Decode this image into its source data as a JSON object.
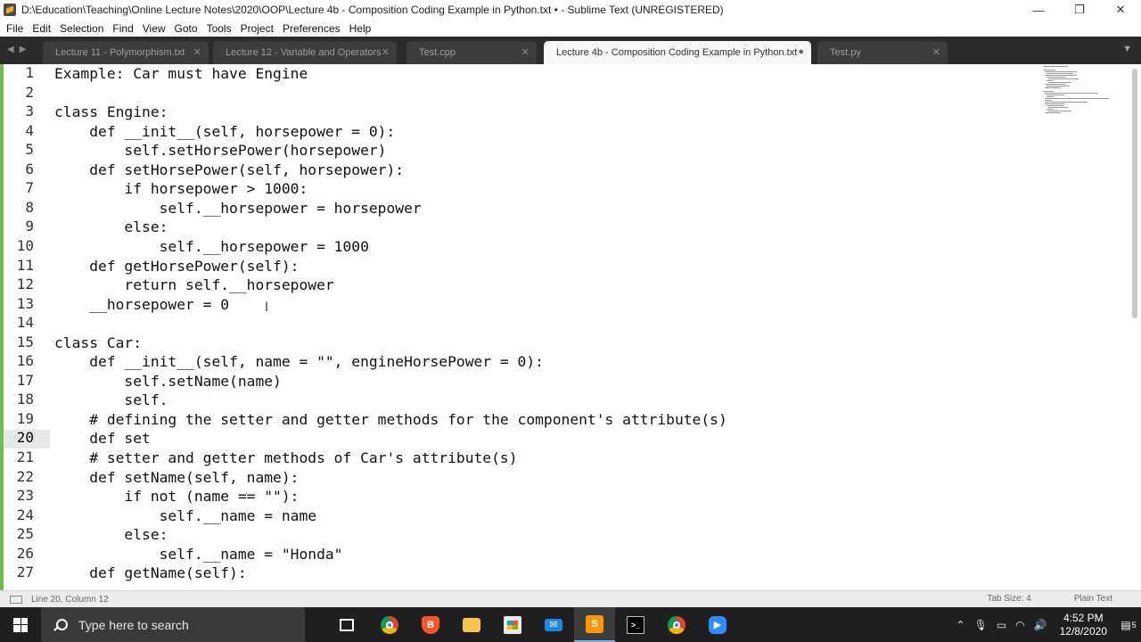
{
  "window": {
    "title": "D:\\Education\\Teaching\\Online Lecture Notes\\2020\\OOP\\Lecture 4b - Composition Coding Example in Python.txt • - Sublime Text (UNREGISTERED)",
    "minimize": "—",
    "restore": "❐",
    "close": "✕"
  },
  "menu": [
    "File",
    "Edit",
    "Selection",
    "Find",
    "View",
    "Goto",
    "Tools",
    "Project",
    "Preferences",
    "Help"
  ],
  "tabs": [
    {
      "label": "Lecture 11 - Polymorphism.txt",
      "close": "✕",
      "active": false
    },
    {
      "label": "Lecture 12 - Variable and Operators",
      "close": "✕",
      "active": false
    },
    {
      "label": "Test.cpp",
      "close": "✕",
      "active": false
    },
    {
      "label": "Lecture 4b - Composition Coding Example in Python.txt",
      "close": "●",
      "active": true
    },
    {
      "label": "Test.py",
      "close": "✕",
      "active": false
    }
  ],
  "editor": {
    "current_line": 20,
    "line_numbers": [
      "1",
      "2",
      "3",
      "4",
      "5",
      "6",
      "7",
      "8",
      "9",
      "10",
      "11",
      "12",
      "13",
      "14",
      "15",
      "16",
      "17",
      "18",
      "19",
      "20",
      "21",
      "22",
      "23",
      "24",
      "25",
      "26",
      "27"
    ],
    "lines": [
      "Example: Car must have Engine",
      "",
      "class Engine:",
      "    def __init__(self, horsepower = 0):",
      "        self.setHorsePower(horsepower)",
      "    def setHorsePower(self, horsepower):",
      "        if horsepower > 1000:",
      "            self.__horsepower = horsepower",
      "        else:",
      "            self.__horsepower = 1000",
      "    def getHorsePower(self):",
      "        return self.__horsepower",
      "    __horsepower = 0",
      "",
      "class Car:",
      "    def __init__(self, name = \"\", engineHorsePower = 0):",
      "        self.setName(name)",
      "        self.",
      "    # defining the setter and getter methods for the component's attribute(s)",
      "    def set",
      "    # setter and getter methods of Car's attribute(s)",
      "    def setName(self, name):",
      "        if not (name == \"\"):",
      "            self.__name = name",
      "        else:",
      "            self.__name = \"Honda\"",
      "    def getName(self):"
    ]
  },
  "statusbar": {
    "position": "Line 20, Column 12",
    "tab_size": "Tab Size: 4",
    "syntax": "Plain Text"
  },
  "taskbar": {
    "search_placeholder": "Type here to search",
    "time": "4:52 PM",
    "date": "12/8/2020",
    "notification_count": "5"
  },
  "colors": {
    "tab_bar": "#2b2b2b",
    "active_tab": "#f7f7f7",
    "modified_marker": "#6fbf4a",
    "taskbar": "#1f1f1f"
  }
}
